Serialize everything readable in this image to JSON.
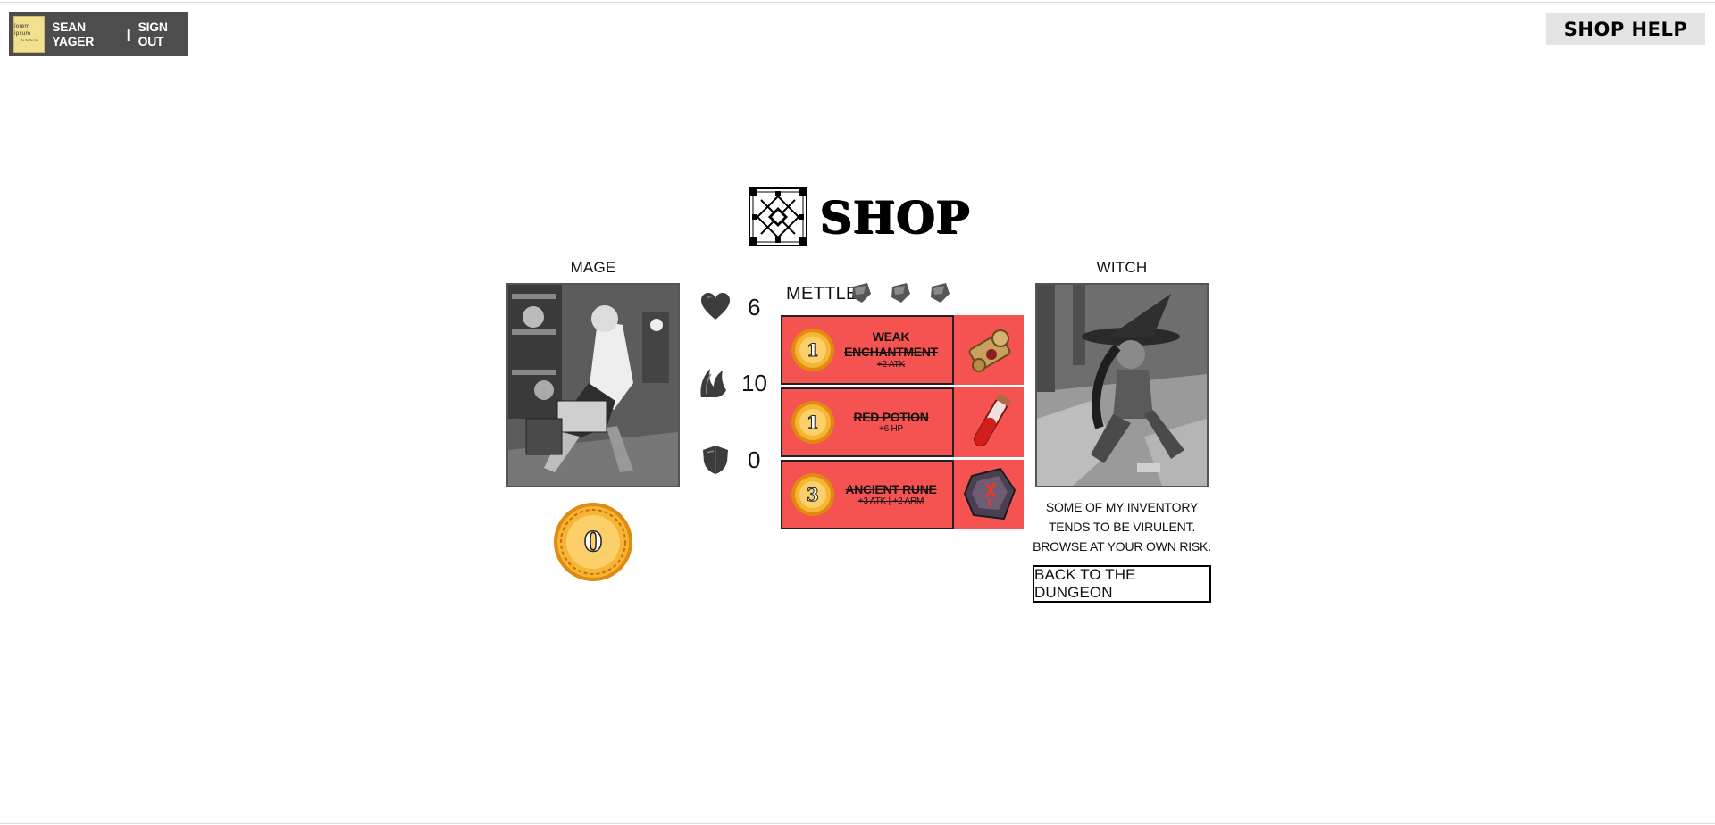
{
  "user": {
    "name": "SEAN YAGER",
    "separator": "|",
    "signout_label": "SIGN OUT",
    "avatar_icon": "sticky-note-avatar"
  },
  "help": {
    "label": "SHOP HELP"
  },
  "shop": {
    "title": "SHOP"
  },
  "player": {
    "class_label": "MAGE",
    "hp": "6",
    "attack": "10",
    "armor": "0",
    "coins": "0"
  },
  "mettle": {
    "label": "METTLE",
    "stones": 3
  },
  "items": [
    {
      "cost": "1",
      "name": "WEAK ENCHANTMENT",
      "effect": "+2 ATK",
      "icon": "scroll-icon"
    },
    {
      "cost": "1",
      "name": "RED POTION",
      "effect": "+6 HP",
      "icon": "potion-icon"
    },
    {
      "cost": "3",
      "name": "ANCIENT RUNE",
      "effect": "+3 ATK | +2 ARM",
      "icon": "rune-icon"
    }
  ],
  "merchant": {
    "class_label": "WITCH",
    "quote": "SOME OF MY INVENTORY TENDS TO BE VIRULENT. BROWSE AT YOUR OWN RISK."
  },
  "back_button": {
    "label": "BACK TO THE DUNGEON"
  },
  "colors": {
    "item_bg": "#f55252",
    "userbar_bg": "#4d4d4d",
    "coin_gold": "#f2a81c"
  }
}
